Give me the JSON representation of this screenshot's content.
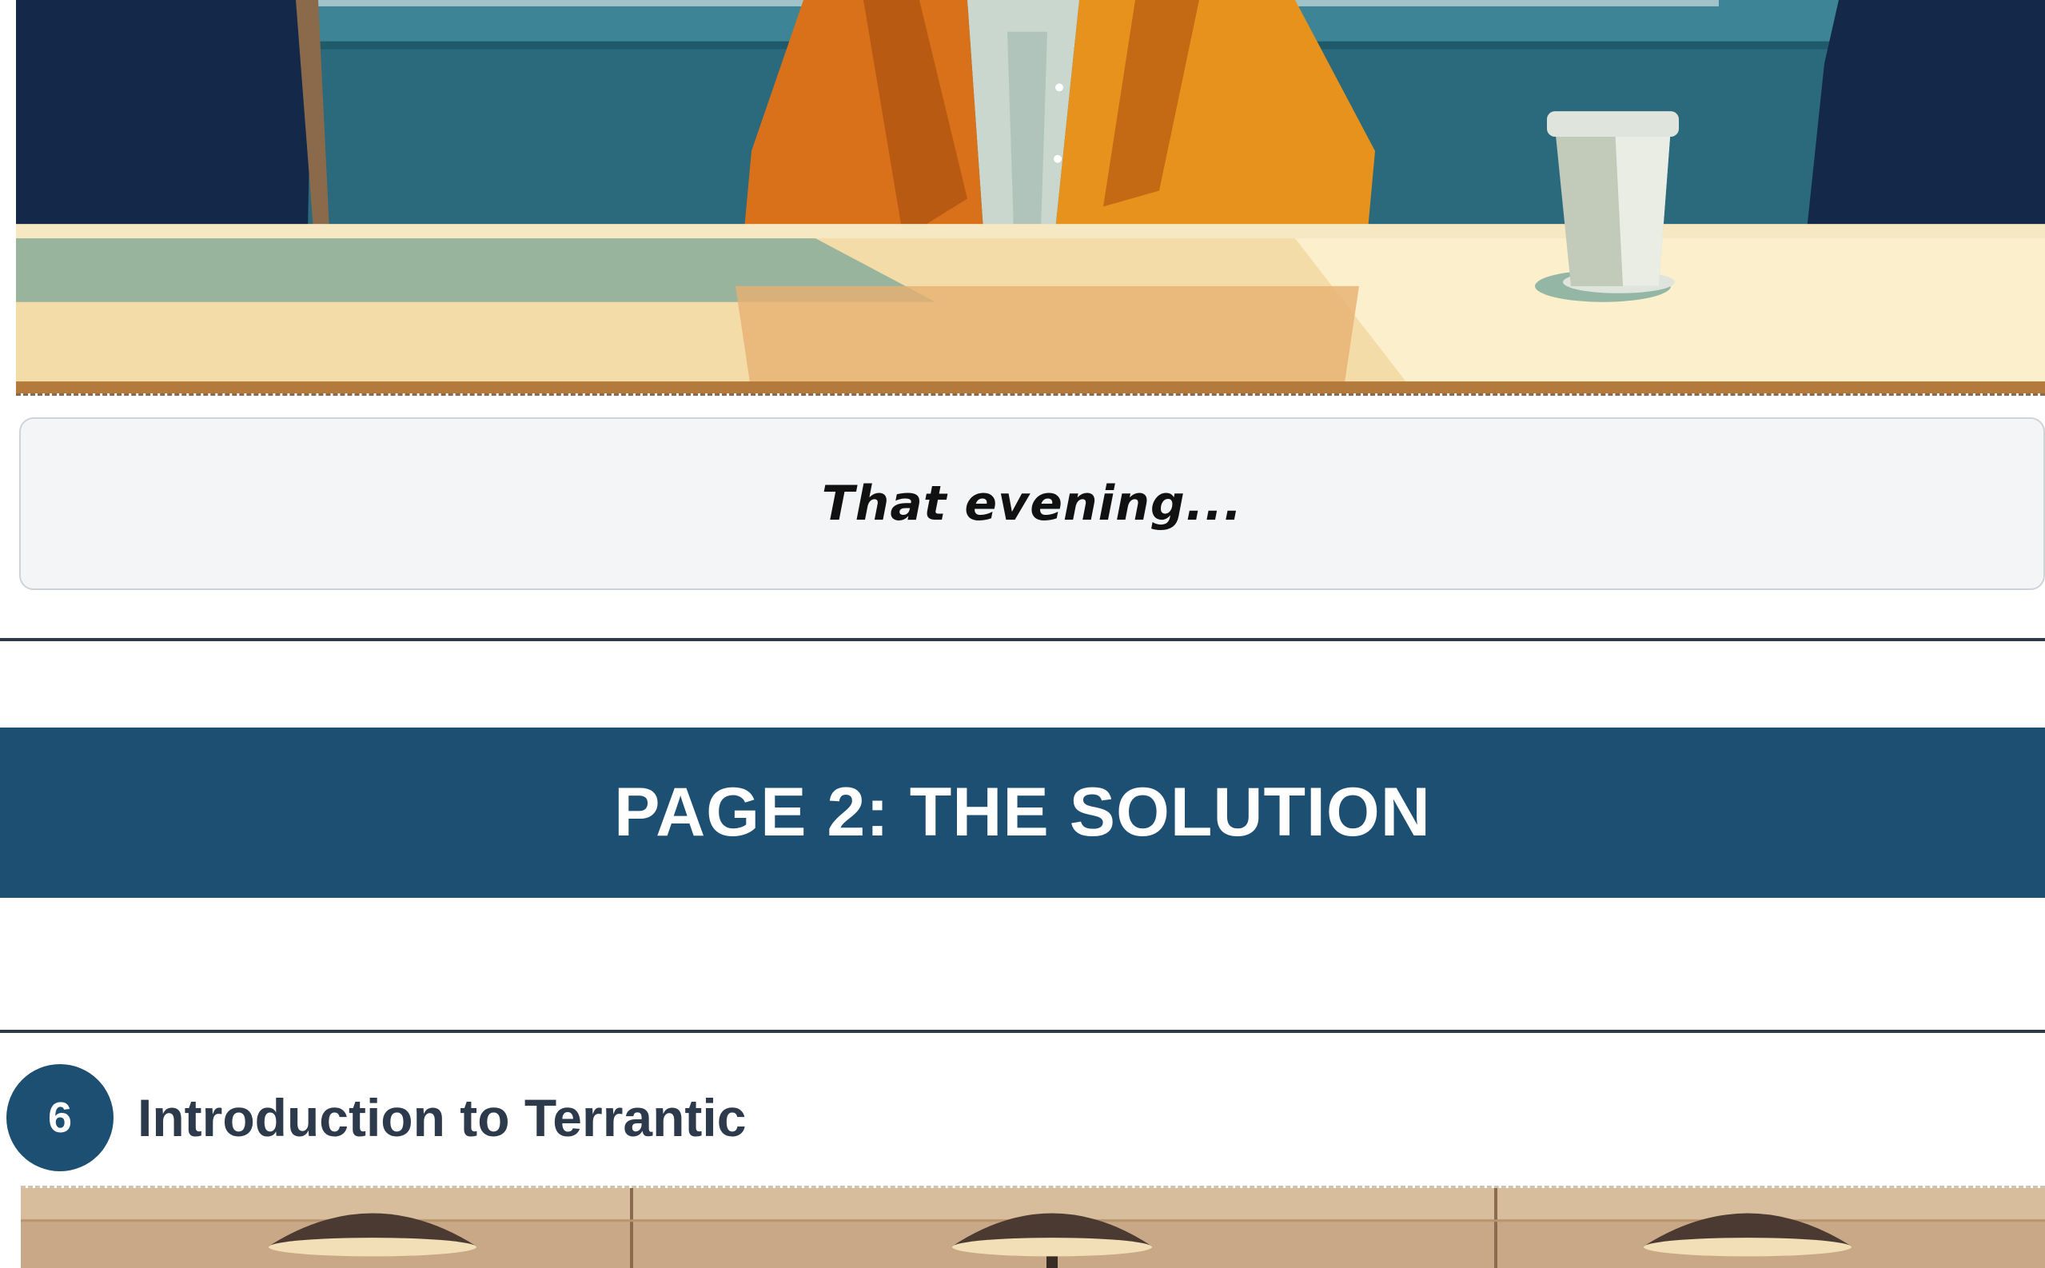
{
  "caption": {
    "text": "That evening..."
  },
  "page_banner": {
    "title": "PAGE 2: THE SOLUTION"
  },
  "section": {
    "number": "6",
    "title": "Introduction to Terrantic"
  },
  "illustrations": {
    "top_panel": "office-scene-illustration",
    "next_panel": "lamps-scene-illustration"
  },
  "colors": {
    "banner": "#1d4f72",
    "badge": "#1d4f72",
    "divider": "#2e3a48",
    "caption_bg": "#f4f5f7",
    "section_title": "#2d3a4b"
  }
}
